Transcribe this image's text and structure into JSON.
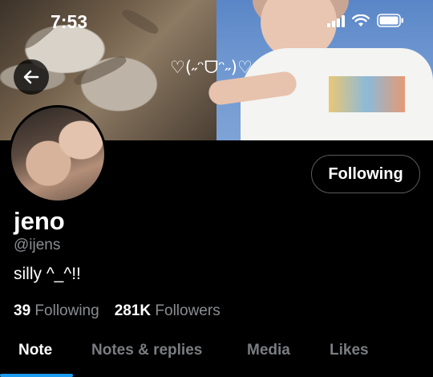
{
  "status_bar": {
    "time": "7:53",
    "signal_icon": "cellular-signal-icon",
    "wifi_icon": "wifi-icon",
    "battery_icon": "battery-icon"
  },
  "header": {
    "back_icon": "arrow-left-icon",
    "banner_text": "♡(˶ᵔᗜᵔ˶)♡"
  },
  "profile": {
    "name": "jeno",
    "handle": "@ijens",
    "bio": "silly ^_^!!",
    "follow_button_label": "Following",
    "following_count": "39",
    "following_label": "Following",
    "followers_count": "281K",
    "followers_label": "Followers"
  },
  "tabs": [
    {
      "label": "Note",
      "active": true
    },
    {
      "label": "Notes & replies",
      "active": false
    },
    {
      "label": "Media",
      "active": false
    },
    {
      "label": "Likes",
      "active": false
    }
  ],
  "colors": {
    "accent": "#1d9bf0",
    "muted_text": "#8a8d91",
    "background": "#000000"
  }
}
